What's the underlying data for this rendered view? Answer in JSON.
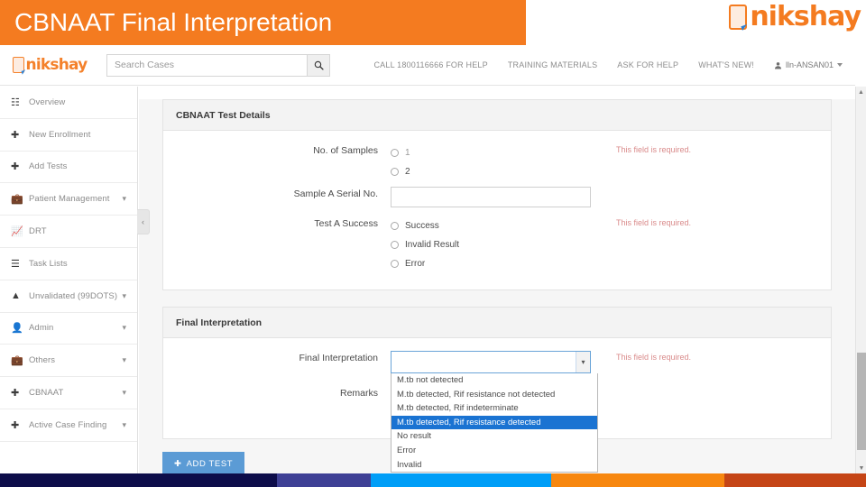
{
  "slide": {
    "banner_title": "CBNAAT Final Interpretation",
    "brand_logo_text": "nikshay"
  },
  "appbar": {
    "logo_text": "nikshay",
    "search": {
      "placeholder": "Search Cases",
      "value": "",
      "button_icon": "search-icon"
    },
    "nav_links": [
      "CALL 1800116666 FOR HELP",
      "TRAINING MATERIALS",
      "ASK FOR HELP",
      "WHAT'S NEW!"
    ],
    "user": {
      "name": "lln-ANSAN01",
      "icon": "user-icon",
      "caret": "▼"
    }
  },
  "sidebar": {
    "collapse_toggle": "‹",
    "items": [
      {
        "label": "Overview",
        "icon": "📊",
        "has_chevron": false
      },
      {
        "label": "New Enrollment",
        "icon": "✚",
        "has_chevron": false
      },
      {
        "label": "Add Tests",
        "icon": "✚",
        "has_chevron": false
      },
      {
        "label": "Patient Management",
        "icon": "🗂",
        "has_chevron": true
      },
      {
        "label": "DRT",
        "icon": "📈",
        "has_chevron": false
      },
      {
        "label": "Task Lists",
        "icon": "☰",
        "has_chevron": false
      },
      {
        "label": "Unvalidated (99DOTS)",
        "icon": "⚠",
        "has_chevron": true
      },
      {
        "label": "Admin",
        "icon": "👤",
        "has_chevron": true
      },
      {
        "label": "Others",
        "icon": "🗂",
        "has_chevron": true
      },
      {
        "label": "CBNAAT",
        "icon": "✚",
        "has_chevron": true
      },
      {
        "label": "Active Case Finding",
        "icon": "✚",
        "has_chevron": true
      }
    ]
  },
  "main": {
    "test_details": {
      "panel_title": "CBNAAT Test Details",
      "no_of_samples": {
        "label": "No. of Samples",
        "options": [
          "1",
          "2"
        ],
        "selected": "",
        "error": "This field is required."
      },
      "sample_a_serial": {
        "label": "Sample A Serial No.",
        "value": "",
        "placeholder": ""
      },
      "test_a_success": {
        "label": "Test A Success",
        "options": [
          "Success",
          "Invalid Result",
          "Error"
        ],
        "selected": "",
        "error": "This field is required."
      }
    },
    "final_interpretation": {
      "panel_title": "Final Interpretation",
      "field": {
        "label": "Final Interpretation",
        "value": "",
        "error": "This field is required.",
        "dropdown_open": true,
        "options": [
          "M.tb not detected",
          "M.tb detected, Rif resistance not detected",
          "M.tb detected, Rif indeterminate",
          "M.tb detected, Rif resistance detected",
          "No result",
          "Error",
          "Invalid"
        ],
        "highlighted_option": "M.tb detected, Rif resistance detected"
      },
      "remarks": {
        "label": "Remarks",
        "value": ""
      }
    },
    "add_test_button": {
      "label": "ADD TEST",
      "icon": "✚"
    }
  },
  "scrollbar": {
    "up_arrow": "▲",
    "down_arrow": "▼"
  },
  "footer_strip": {
    "colors": [
      "#0d0d4a",
      "#3e4095",
      "#009ef7",
      "#f7870f",
      "#c54516"
    ]
  },
  "theme": {
    "banner_orange": "#F47B20",
    "brand_orange": "#F47B20",
    "accent_blue": "#5b9bd5",
    "highlight_blue": "#1a73d2",
    "error_red": "#d98a8a"
  }
}
